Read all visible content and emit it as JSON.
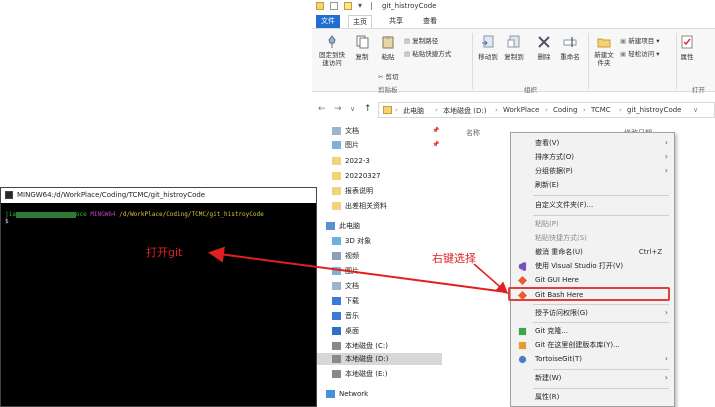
{
  "explorer": {
    "title": "git_histroyCode",
    "tabs": [
      "文件",
      "主页",
      "共享",
      "查看"
    ],
    "ribbon": {
      "pin_label": "固定到快速访问",
      "copy_label": "复制",
      "paste_label": "粘贴",
      "copy_path_label": "复制路径",
      "paste_shortcut_label": "粘贴快捷方式",
      "cut_label": "剪切",
      "clipboard_group": "剪贴板",
      "move_to_label": "移动到",
      "copy_to_label": "复制到",
      "delete_label": "删除",
      "rename_label": "重命名",
      "organize_group": "组织",
      "new_folder_label": "新建文件夹",
      "new_item_label": "新建项目",
      "easy_access_label": "轻松访问",
      "properties_label": "属性",
      "open_group": "打开"
    },
    "breadcrumb": [
      "此电脑",
      "本地磁盘 (D:)",
      "WorkPlace",
      "Coding",
      "TCMC",
      "git_histroyCode"
    ],
    "nav": {
      "quick": [
        "文档",
        "图片",
        "2022-3",
        "20220327",
        "报表说明",
        "出差相关资料"
      ],
      "this_pc": "此电脑",
      "pc_items": [
        "3D 对象",
        "视频",
        "图片",
        "文档",
        "下载",
        "音乐",
        "桌面",
        "本地磁盘 (C:)",
        "本地磁盘 (D:)",
        "本地磁盘 (E:)"
      ],
      "network": "Network"
    },
    "columns": {
      "name": "名称",
      "date": "修改日期"
    }
  },
  "context_menu": {
    "items": [
      {
        "label": "查看(V)",
        "arrow": "›"
      },
      {
        "label": "排序方式(O)",
        "arrow": "›"
      },
      {
        "label": "分组依据(P)",
        "arrow": "›"
      },
      {
        "label": "刷新(E)"
      },
      {
        "label": "自定义文件夹(F)..."
      },
      {
        "label": "粘贴(P)"
      },
      {
        "label": "粘贴快捷方式(S)"
      },
      {
        "label": "撤消 重命名(U)",
        "shortcut": "Ctrl+Z"
      },
      {
        "label": "使用 Visual Studio 打开(V)"
      },
      {
        "label": "Git GUI Here"
      },
      {
        "label": "Git Bash Here"
      },
      {
        "label": "授予访问权限(G)",
        "arrow": "›"
      },
      {
        "label": "Git 克隆..."
      },
      {
        "label": "Git 在这里创建版本库(Y)..."
      },
      {
        "label": "TortoiseGit(T)",
        "arrow": "›"
      },
      {
        "label": "新建(W)",
        "arrow": "›"
      },
      {
        "label": "属性(R)"
      }
    ]
  },
  "bash": {
    "title": "MINGW64:/d/WorkPlace/Coding/TCMC/git_histroyCode",
    "prompt_user_start": "jia",
    "prompt_user_end": "oce",
    "prompt_mingw": "MINGW64",
    "prompt_path": "/d/WorkPlace/Coding/TCMC/git_histroyCode",
    "prompt_symbol": "$"
  },
  "annotations": {
    "open_git": "打开git",
    "right_click_select": "右键选择"
  },
  "colors": {
    "accent": "#1e6fd0",
    "annotation": "#e02020",
    "bash_bg": "#000000"
  }
}
